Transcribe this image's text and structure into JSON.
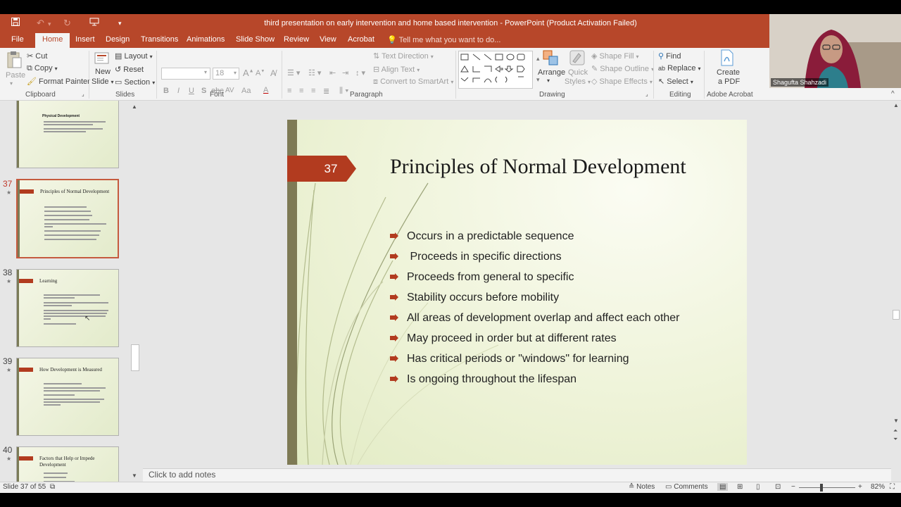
{
  "window": {
    "title": "third presentation on early intervention and home based intervention - PowerPoint (Product Activation Failed)"
  },
  "tabs": [
    "File",
    "Home",
    "Insert",
    "Design",
    "Transitions",
    "Animations",
    "Slide Show",
    "Review",
    "View",
    "Acrobat"
  ],
  "tell_me": "Tell me what you want to do...",
  "ribbon": {
    "clipboard": {
      "paste": "Paste",
      "cut": "Cut",
      "copy": "Copy",
      "format_painter": "Format Painter",
      "label": "Clipboard"
    },
    "slides": {
      "new_slide_1": "New",
      "new_slide_2": "Slide",
      "layout": "Layout",
      "reset": "Reset",
      "section": "Section",
      "label": "Slides"
    },
    "font": {
      "size": "18",
      "bold": "B",
      "italic": "I",
      "underline": "U",
      "strike": "S",
      "shadow": "abc",
      "spacing": "AV",
      "case": "Aa",
      "label": "Font"
    },
    "paragraph": {
      "text_direction": "Text Direction",
      "align_text": "Align Text",
      "convert_smartart": "Convert to SmartArt",
      "label": "Paragraph"
    },
    "drawing": {
      "arrange": "Arrange",
      "quick_styles_1": "Quick",
      "quick_styles_2": "Styles",
      "shape_fill": "Shape Fill",
      "shape_outline": "Shape Outline",
      "shape_effects": "Shape Effects",
      "label": "Drawing"
    },
    "editing": {
      "find": "Find",
      "replace": "Replace",
      "select": "Select",
      "label": "Editing"
    },
    "acrobat": {
      "create_pdf_1": "Create",
      "create_pdf_2": "a PDF",
      "label": "Adobe Acrobat"
    }
  },
  "thumbnails": [
    {
      "num": "",
      "title": "Physical Development"
    },
    {
      "num": "37",
      "title": "Principles of Normal Development"
    },
    {
      "num": "38",
      "title": "Learning"
    },
    {
      "num": "39",
      "title": "How Development is Measured"
    },
    {
      "num": "40",
      "title": "Factors that Help or Impede",
      "title2": "Development"
    }
  ],
  "slide": {
    "number": "37",
    "title": "Principles of Normal Development",
    "bullets": [
      "Occurs in a predictable sequence",
      " Proceeds in specific directions",
      "Proceeds from general to specific",
      "Stability occurs before mobility",
      "All areas of development overlap and affect each other",
      "May proceed in order but at different rates",
      "Has critical periods or \"windows\" for learning",
      "Is ongoing throughout the lifespan"
    ]
  },
  "notes_placeholder": "Click to add notes",
  "status": {
    "slide_of": "Slide 37 of 55",
    "notes": "Notes",
    "comments": "Comments",
    "zoom": "82%"
  },
  "webcam": {
    "participant": "Shagufta Shahzadi"
  },
  "colors": {
    "accent": "#b7472a",
    "slide_tag": "#b23b1f"
  }
}
